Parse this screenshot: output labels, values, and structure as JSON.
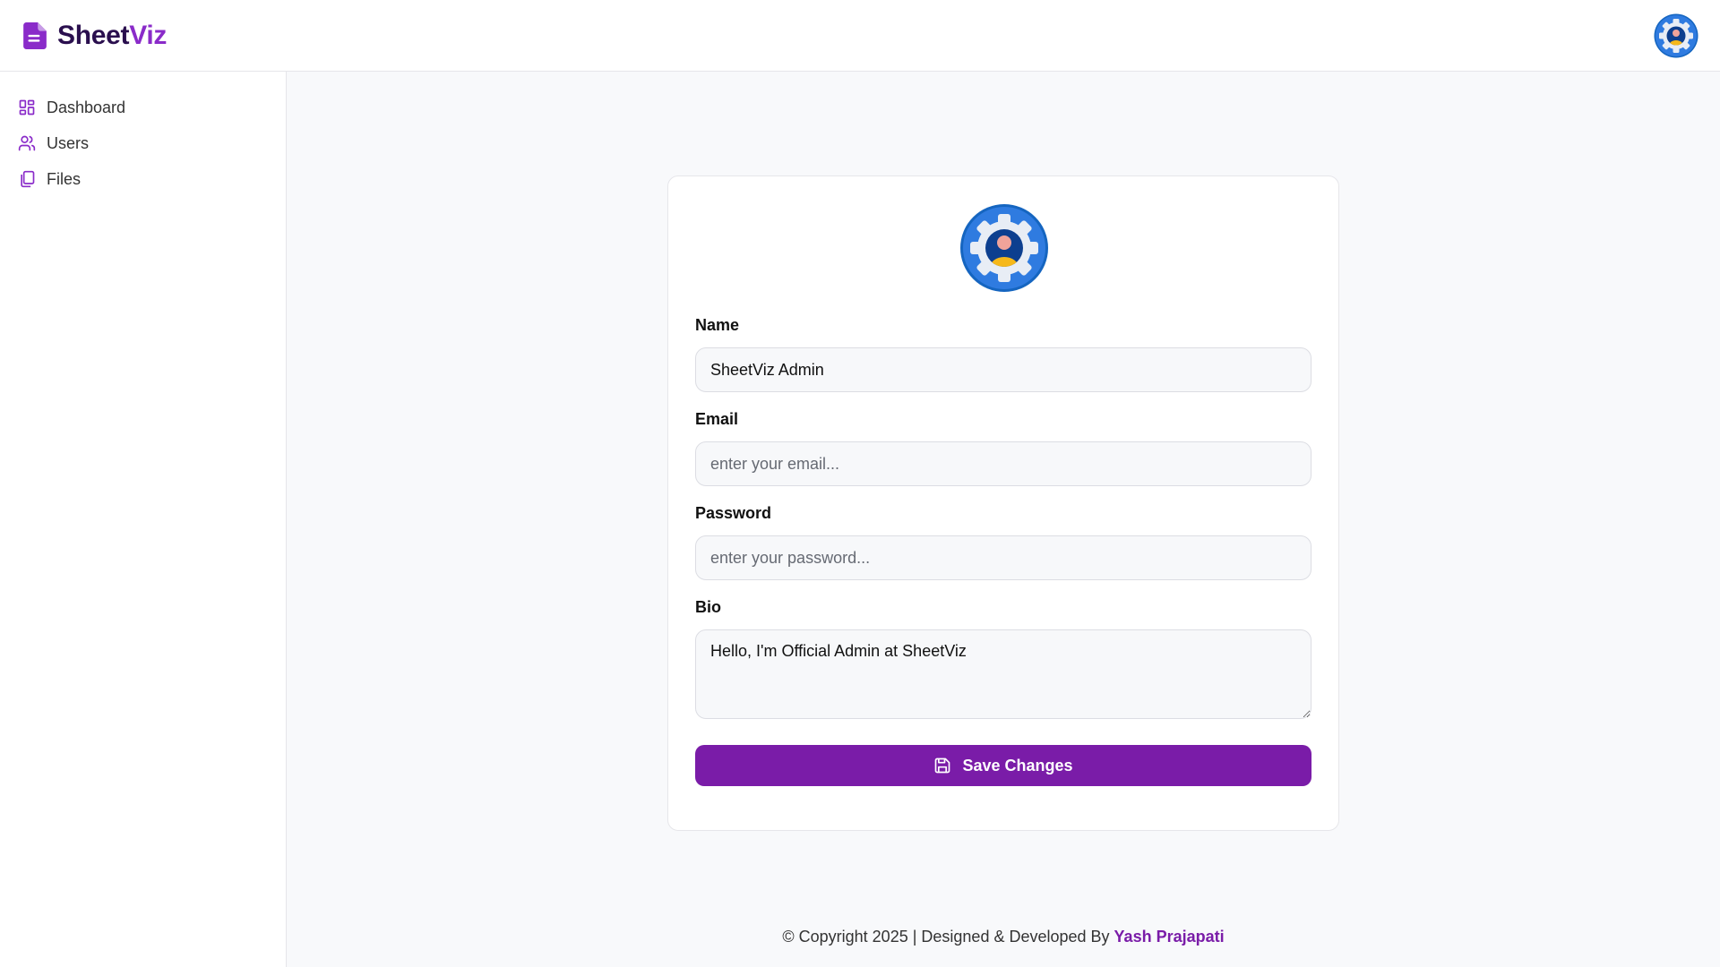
{
  "header": {
    "brand_prefix": "Sheet",
    "brand_suffix": "Viz",
    "avatar_icon": "gear-user-icon"
  },
  "sidebar": {
    "items": [
      {
        "label": "Dashboard",
        "icon": "dashboard-icon"
      },
      {
        "label": "Users",
        "icon": "users-icon"
      },
      {
        "label": "Files",
        "icon": "files-icon"
      }
    ]
  },
  "form": {
    "name_label": "Name",
    "name_value": "SheetViz Admin",
    "email_label": "Email",
    "email_placeholder": "enter your email...",
    "password_label": "Password",
    "password_placeholder": "enter your password...",
    "bio_label": "Bio",
    "bio_value": "Hello, I'm Official Admin at SheetViz",
    "save_label": "Save Changes"
  },
  "footer": {
    "text": "© Copyright 2025 | Designed & Developed By",
    "author": "Yash Prajapati"
  },
  "colors": {
    "accent": "#7a1ca8",
    "brand_dark": "#2a0f4e",
    "brand_light": "#8a2bc9",
    "avatar_blue": "#1565c0"
  }
}
